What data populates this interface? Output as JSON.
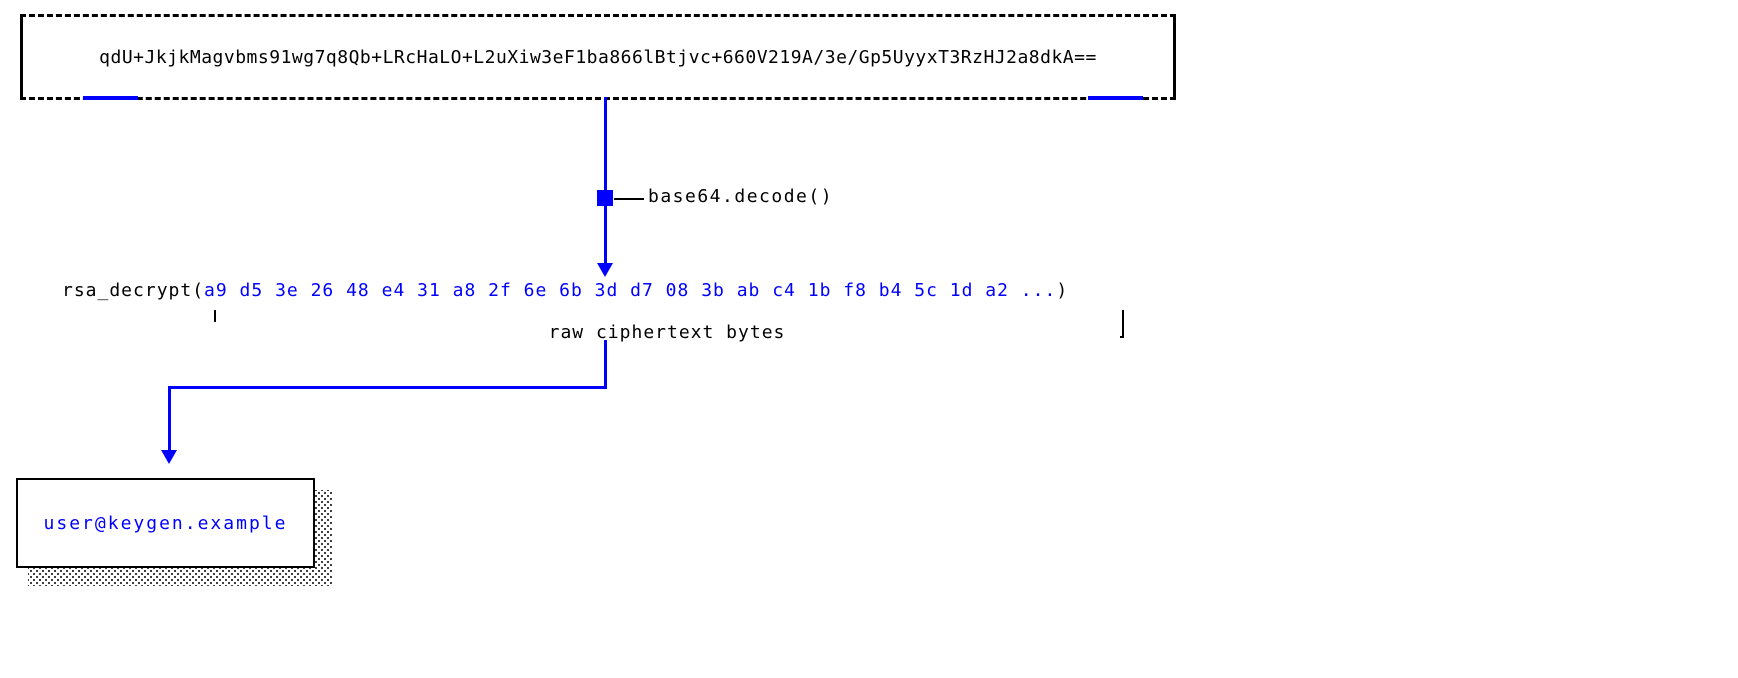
{
  "input": {
    "base64": "qdU+JkjkMagvbms91wg7q8Qb+LRcHaLO+L2uXiw3eF1ba866lBtjvc+660V219A/3e/Gp5UyyxT3RzHJ2a8dkA=="
  },
  "step1": {
    "label": "base64.decode()"
  },
  "decrypt": {
    "fn": "rsa_decrypt(",
    "bytes": "a9 d5 3e 26 48 e4 31 a8 2f 6e 6b 3d d7 08 3b ab c4 1b f8 b4 5c 1d a2 ...",
    "close": ")",
    "bracket_label": "raw ciphertext bytes"
  },
  "output": {
    "plaintext": "user@keygen.example"
  }
}
